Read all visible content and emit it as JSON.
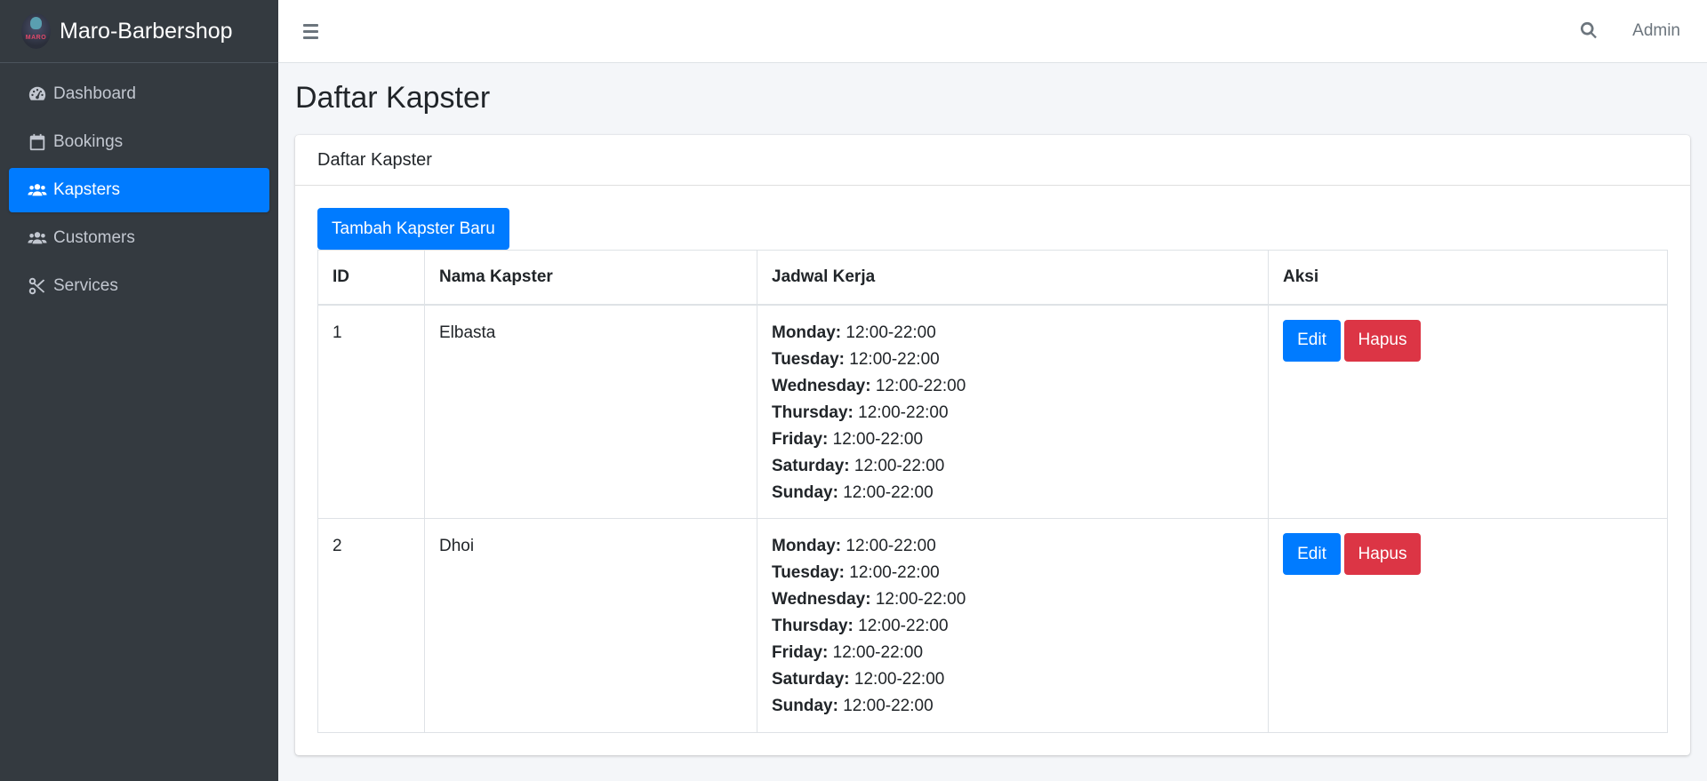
{
  "brand": {
    "name_bold": "Maro",
    "name_rest": "-Barbershop",
    "logo_text": "MARO"
  },
  "sidebar": {
    "items": [
      {
        "label": "Dashboard",
        "icon": "tachometer-icon"
      },
      {
        "label": "Bookings",
        "icon": "calendar-icon"
      },
      {
        "label": "Kapsters",
        "icon": "users-icon",
        "active": true
      },
      {
        "label": "Customers",
        "icon": "users-icon"
      },
      {
        "label": "Services",
        "icon": "scissors-icon"
      }
    ]
  },
  "topbar": {
    "user": "Admin"
  },
  "page": {
    "title": "Daftar Kapster"
  },
  "card": {
    "header": "Daftar Kapster",
    "add_button": "Tambah Kapster Baru"
  },
  "table": {
    "headers": [
      "ID",
      "Nama Kapster",
      "Jadwal Kerja",
      "Aksi"
    ],
    "rows": [
      {
        "id": "1",
        "name": "Elbasta",
        "schedule": [
          {
            "day": "Monday:",
            "time": "12:00-22:00"
          },
          {
            "day": "Tuesday:",
            "time": "12:00-22:00"
          },
          {
            "day": "Wednesday:",
            "time": "12:00-22:00"
          },
          {
            "day": "Thursday:",
            "time": "12:00-22:00"
          },
          {
            "day": "Friday:",
            "time": "12:00-22:00"
          },
          {
            "day": "Saturday:",
            "time": "12:00-22:00"
          },
          {
            "day": "Sunday:",
            "time": "12:00-22:00"
          }
        ],
        "edit": "Edit",
        "delete": "Hapus"
      },
      {
        "id": "2",
        "name": "Dhoi",
        "schedule": [
          {
            "day": "Monday:",
            "time": "12:00-22:00"
          },
          {
            "day": "Tuesday:",
            "time": "12:00-22:00"
          },
          {
            "day": "Wednesday:",
            "time": "12:00-22:00"
          },
          {
            "day": "Thursday:",
            "time": "12:00-22:00"
          },
          {
            "day": "Friday:",
            "time": "12:00-22:00"
          },
          {
            "day": "Saturday:",
            "time": "12:00-22:00"
          },
          {
            "day": "Sunday:",
            "time": "12:00-22:00"
          }
        ],
        "edit": "Edit",
        "delete": "Hapus"
      }
    ]
  },
  "colors": {
    "sidebar_bg": "#343a40",
    "primary": "#007bff",
    "danger": "#dc3545",
    "page_bg": "#f4f6f9"
  }
}
